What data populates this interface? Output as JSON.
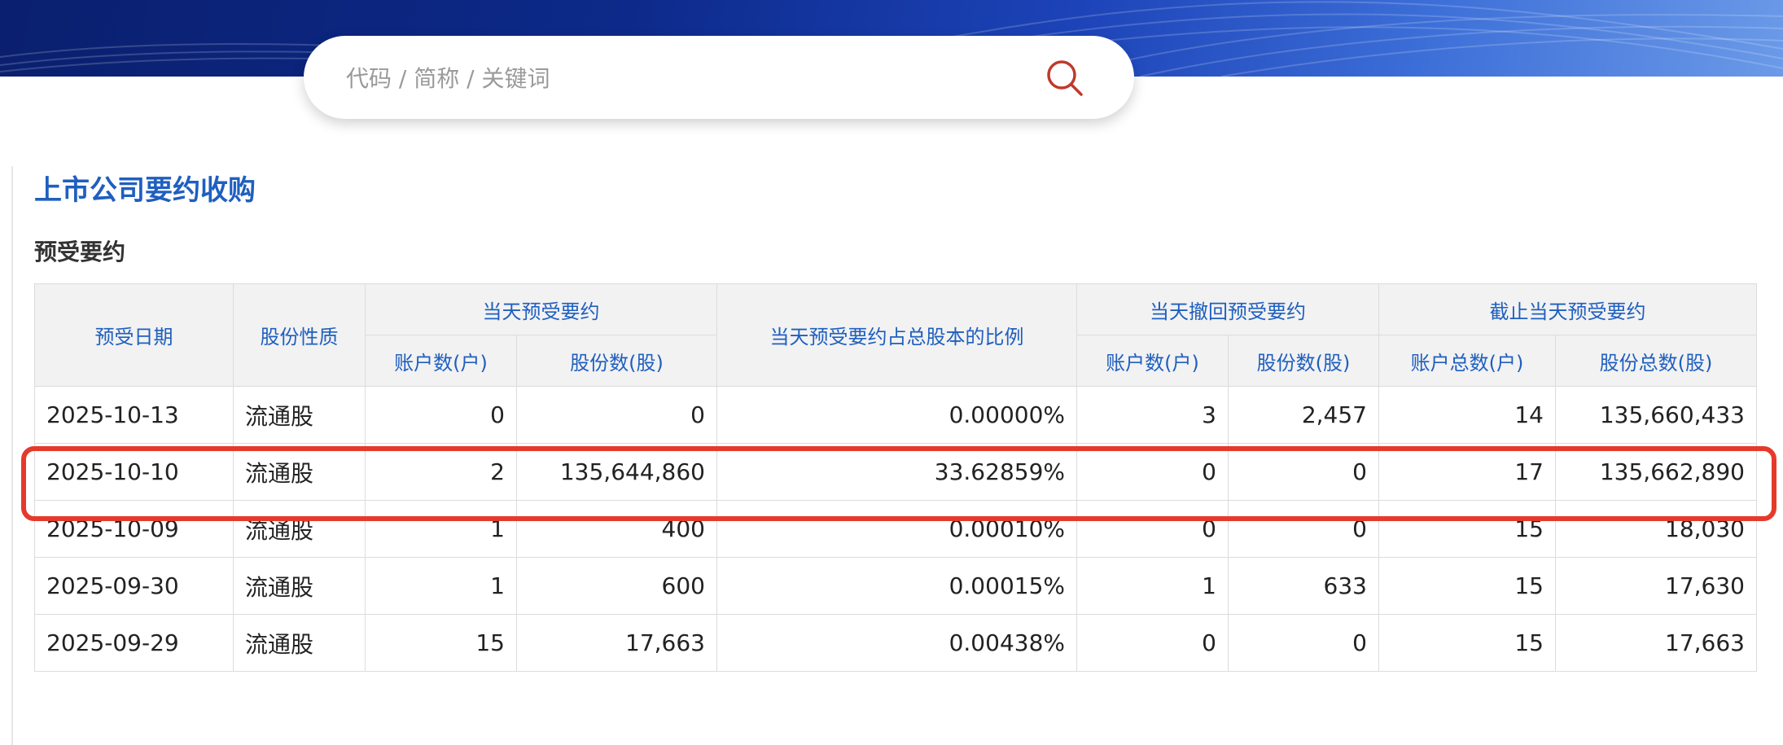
{
  "search": {
    "placeholder": "代码 / 简称 / 关键词"
  },
  "page_title": "上市公司要约收购",
  "section_title": "预受要约",
  "table": {
    "headers": {
      "date": "预受日期",
      "nature": "股份性质",
      "group_today_accept": "当天预受要约",
      "ratio": "当天预受要约占总股本的比例",
      "group_today_withdraw": "当天撤回预受要约",
      "group_cumulative": "截止当天预受要约",
      "accounts": "账户数(户)",
      "shares": "股份数(股)",
      "total_accounts": "账户总数(户)",
      "total_shares": "股份总数(股)"
    },
    "rows": [
      {
        "date": "2025-10-13",
        "nature": "流通股",
        "accept_accounts": "0",
        "accept_shares": "0",
        "ratio": "0.00000%",
        "withdraw_accounts": "3",
        "withdraw_shares": "2,457",
        "total_accounts": "14",
        "total_shares": "135,660,433"
      },
      {
        "date": "2025-10-10",
        "nature": "流通股",
        "accept_accounts": "2",
        "accept_shares": "135,644,860",
        "ratio": "33.62859%",
        "withdraw_accounts": "0",
        "withdraw_shares": "0",
        "total_accounts": "17",
        "total_shares": "135,662,890"
      },
      {
        "date": "2025-10-09",
        "nature": "流通股",
        "accept_accounts": "1",
        "accept_shares": "400",
        "ratio": "0.00010%",
        "withdraw_accounts": "0",
        "withdraw_shares": "0",
        "total_accounts": "15",
        "total_shares": "18,030"
      },
      {
        "date": "2025-09-30",
        "nature": "流通股",
        "accept_accounts": "1",
        "accept_shares": "600",
        "ratio": "0.00015%",
        "withdraw_accounts": "1",
        "withdraw_shares": "633",
        "total_accounts": "15",
        "total_shares": "17,630"
      },
      {
        "date": "2025-09-29",
        "nature": "流通股",
        "accept_accounts": "15",
        "accept_shares": "17,663",
        "ratio": "0.00438%",
        "withdraw_accounts": "0",
        "withdraw_shares": "0",
        "total_accounts": "15",
        "total_shares": "17,663"
      }
    ]
  },
  "colors": {
    "banner": "#0d2a8a",
    "title": "#1f5fbf",
    "header_bg": "#f2f2f2",
    "highlight": "#e53a2b"
  },
  "icons": {
    "search": "search-icon"
  }
}
